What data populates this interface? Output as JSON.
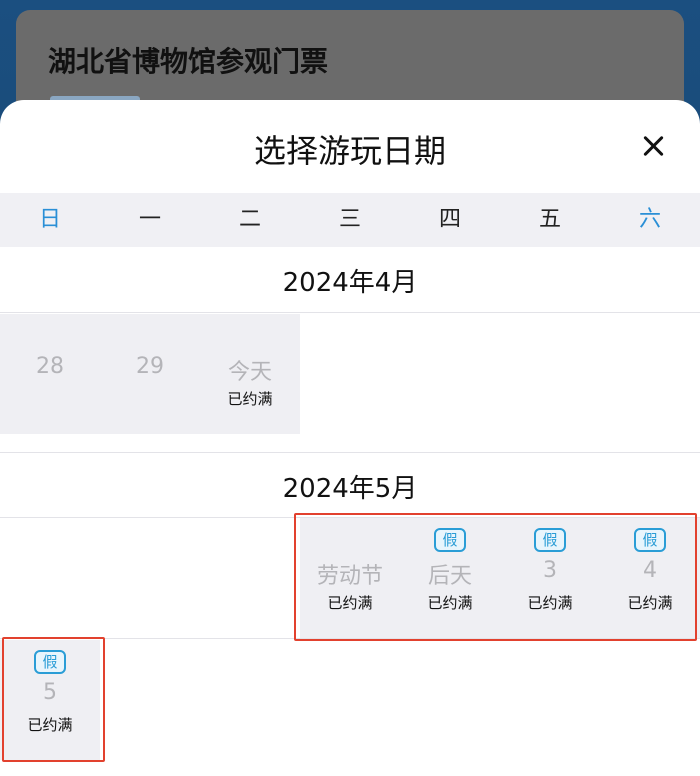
{
  "background": {
    "title": "湖北省博物馆参观门票"
  },
  "sheet": {
    "title": "选择游玩日期",
    "close_label": "×"
  },
  "weekdays": [
    "日",
    "一",
    "二",
    "三",
    "四",
    "五",
    "六"
  ],
  "months": [
    {
      "label": "2024年4月",
      "days": [
        {
          "num": "28",
          "status": "",
          "holiday": ""
        },
        {
          "num": "29",
          "status": "",
          "holiday": ""
        },
        {
          "num": "今天",
          "status": "已约满",
          "holiday": ""
        }
      ]
    },
    {
      "label": "2024年5月",
      "days": [
        {
          "num": "劳动节",
          "status": "已约满",
          "holiday": ""
        },
        {
          "num": "后天",
          "status": "已约满",
          "holiday": "假"
        },
        {
          "num": "3",
          "status": "已约满",
          "holiday": "假"
        },
        {
          "num": "4",
          "status": "已约满",
          "holiday": "假"
        },
        {
          "num": "5",
          "status": "已约满",
          "holiday": "假"
        }
      ]
    }
  ],
  "colors": {
    "weekend": "#2a8fd6",
    "holiday_badge": "#2a9dd6",
    "highlight_box": "#e2412e"
  }
}
